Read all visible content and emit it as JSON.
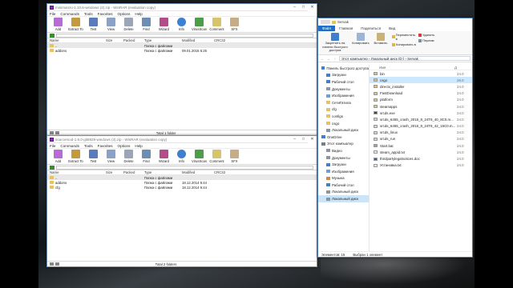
{
  "winrar_top": {
    "title": "minimanzo-1.10.6-windows (2).zip - WinRAR (evaluation copy)",
    "menu": [
      "File",
      "Commands",
      "Tools",
      "Favorites",
      "Options",
      "Help"
    ],
    "toolbar": [
      "Add",
      "Extract To",
      "Test",
      "View",
      "Delete",
      "Find",
      "Wizard",
      "Info",
      "VirusScan",
      "Comment",
      "SFX"
    ],
    "columns": [
      "Name",
      "Size",
      "Packed",
      "Type",
      "Modified",
      "CRC32"
    ],
    "rows": [
      {
        "name": "..",
        "type": "Папка с файлами",
        "modified": ""
      },
      {
        "name": "addons",
        "type": "Папка с файлами",
        "modified": "09.01.2015 6:25"
      }
    ],
    "status": "Total 1 folder"
  },
  "winrar_bottom": {
    "title": "sourcemod-1.8.0-git5928-windows (3).zip - WinRAR (evaluation copy)",
    "menu": [
      "File",
      "Commands",
      "Tools",
      "Favorites",
      "Options",
      "Help"
    ],
    "toolbar": [
      "Add",
      "Extract To",
      "Test",
      "View",
      "Delete",
      "Find",
      "Wizard",
      "Info",
      "VirusScan",
      "Comment",
      "SFX"
    ],
    "columns": [
      "Name",
      "Size",
      "Packed",
      "Type",
      "Modified",
      "CRC32"
    ],
    "rows": [
      {
        "name": "..",
        "type": "Папка с файлами",
        "modified": ""
      },
      {
        "name": "addons",
        "type": "Папка с файлами",
        "modified": "18.12.2014 6:44"
      },
      {
        "name": "cfg",
        "type": "Папка с файлами",
        "modified": "18.12.2014 6:44"
      }
    ],
    "status": "Total 2 folders"
  },
  "explorer": {
    "title": "Servak",
    "tabs": [
      "Файл",
      "Главная",
      "Поделиться",
      "Вид"
    ],
    "ribbon": {
      "pin": "Закрепить на панели быстрого доступа",
      "copy": "Копировать",
      "paste": "Вставить",
      "move": "Переместить в",
      "copy_to": "Копировать в",
      "delete": "Удалить",
      "rename": "Переим"
    },
    "address": "Этот компьютер › Локальный диск (D:) › Servak",
    "nav": [
      {
        "label": "Панель быстрого доступа",
        "sub": false
      },
      {
        "label": "Загрузки",
        "sub": true
      },
      {
        "label": "Рабочий стол",
        "sub": true
      },
      {
        "label": "Документы",
        "sub": true
      },
      {
        "label": "Изображения",
        "sub": true
      },
      {
        "label": "СетиГатила",
        "sub": true
      },
      {
        "label": "cfg",
        "sub": true
      },
      {
        "label": "configs",
        "sub": true
      },
      {
        "label": "csgo",
        "sub": true
      },
      {
        "label": "Локальный диск",
        "sub": true
      },
      {
        "label": "OneDrive",
        "sub": false
      },
      {
        "label": "Этот компьютер",
        "sub": false
      },
      {
        "label": "Видео",
        "sub": true
      },
      {
        "label": "Документы",
        "sub": true
      },
      {
        "label": "Загрузки",
        "sub": true
      },
      {
        "label": "Изображения",
        "sub": true
      },
      {
        "label": "Музыка",
        "sub": true
      },
      {
        "label": "Рабочий стол",
        "sub": true
      },
      {
        "label": "Локальный диск",
        "sub": true
      },
      {
        "label": "Локальный диск",
        "sub": true,
        "selected": true
      }
    ],
    "head_name": "Имя",
    "head_date": "Д",
    "files": [
      {
        "name": "bin",
        "date": "24.0",
        "kind": "folder"
      },
      {
        "name": "csgo",
        "date": "26.0",
        "kind": "folder",
        "selected": true
      },
      {
        "name": "directx_installer",
        "date": "24.0",
        "kind": "folder"
      },
      {
        "name": "FastDownload",
        "date": "24.0",
        "kind": "folder"
      },
      {
        "name": "platform",
        "date": "24.0",
        "kind": "folder"
      },
      {
        "name": "steamapps",
        "date": "24.0",
        "kind": "folder"
      },
      {
        "name": "srcds.exe",
        "date": "24.0",
        "kind": "exe"
      },
      {
        "name": "srcds_6455_crash_2016_8_24T9_40_8C0.m...",
        "date": "24.0",
        "kind": "file"
      },
      {
        "name": "srcds_6455_crash_2016_8_24T9_42_15C0.m...",
        "date": "24.0",
        "kind": "file"
      },
      {
        "name": "srcds_linux",
        "date": "24.0",
        "kind": "file"
      },
      {
        "name": "srcds_run",
        "date": "24.0",
        "kind": "file"
      },
      {
        "name": "Start.bat",
        "date": "24.0",
        "kind": "bat"
      },
      {
        "name": "steam_appid.txt",
        "date": "24.0",
        "kind": "txt"
      },
      {
        "name": "thirdpartylegalnotices.doc",
        "date": "24.0",
        "kind": "doc"
      },
      {
        "name": "Установка.txt",
        "date": "24.0",
        "kind": "txt"
      }
    ],
    "status_count": "Элементов: 15",
    "status_selected": "Выбран 1 элемент"
  },
  "colors": {
    "winrar_border": "#6f8fb8",
    "explorer_accent": "#1e6fc9",
    "folder": "#e8c25a",
    "selection": "#cce8ff"
  }
}
